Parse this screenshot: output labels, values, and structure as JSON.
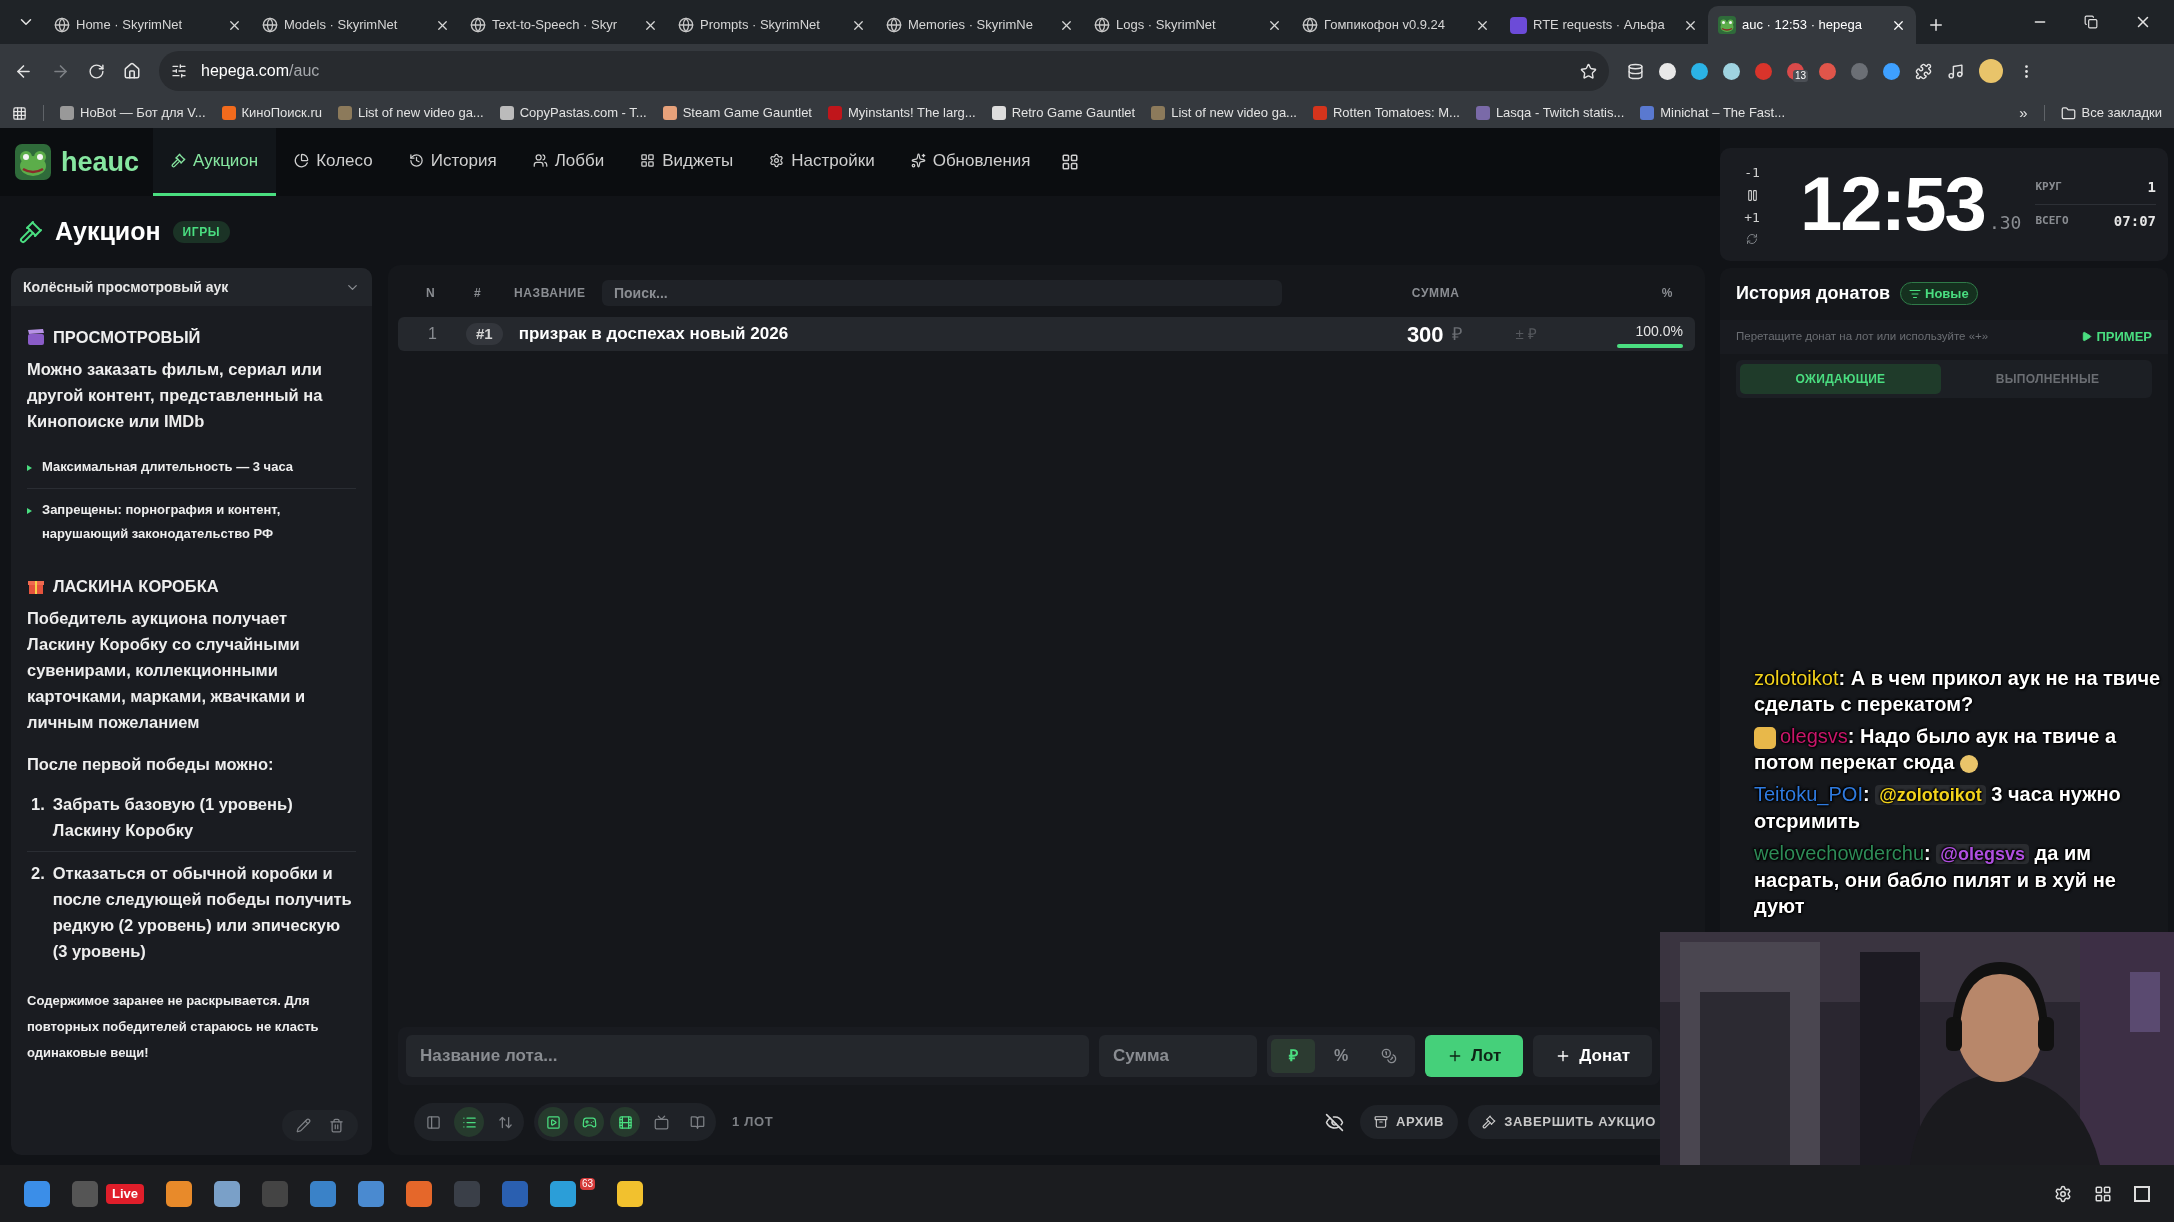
{
  "browser": {
    "tabs": [
      {
        "title": "Home · SkyrimNet",
        "selected": false
      },
      {
        "title": "Models · SkyrimNet",
        "selected": false
      },
      {
        "title": "Text-to-Speech · Skyr",
        "selected": false
      },
      {
        "title": "Prompts · SkyrimNet",
        "selected": false
      },
      {
        "title": "Memories · SkyrimNe",
        "selected": false
      },
      {
        "title": "Logs · SkyrimNet",
        "selected": false
      },
      {
        "title": "Гомпикофон v0.9.24",
        "selected": false
      },
      {
        "title": "RTE requests · Альфа",
        "selected": false
      },
      {
        "title": "auc · 12:53 · hepega",
        "selected": true
      }
    ],
    "address": {
      "host": "hepega.com",
      "path": "/auc"
    },
    "extension_badge": "13",
    "bookmarks": [
      "HoBot — Бот для V...",
      "КиноПоиск.ru",
      "List of new video ga...",
      "CopyPastas.com - T...",
      "Steam Game Gauntlet",
      "Myinstants! The larg...",
      "Retro Game Gauntlet",
      "List of new video ga...",
      "Rotten Tomatoes: M...",
      "Lasqa - Twitch statis...",
      "Minichat – The Fast..."
    ],
    "more_bookmarks": "»",
    "all_bookmarks": "Все закладки"
  },
  "app": {
    "logo": "heauc",
    "nav": [
      {
        "label": "Аукцион",
        "selected": true
      },
      {
        "label": "Колесо",
        "selected": false
      },
      {
        "label": "История",
        "selected": false
      },
      {
        "label": "Лобби",
        "selected": false
      },
      {
        "label": "Виджеты",
        "selected": false
      },
      {
        "label": "Настройки",
        "selected": false
      },
      {
        "label": "Обновления",
        "selected": false
      }
    ]
  },
  "page": {
    "title": "Аукцион",
    "badge": "ИГРЫ"
  },
  "rules": {
    "preset": "Колёсный просмотровый аук",
    "blocks": [
      {
        "kind": "heading",
        "text": "ПРОСМОТРОВЫЙ"
      },
      {
        "kind": "paragraph",
        "text": "Можно заказать фильм, сериал или другой контент, представленный на **Кинопоиске** или **IMDb**"
      },
      {
        "kind": "bullets",
        "items": [
          "Максимальная длительность — 3 часа",
          "Запрещены: порнография и контент, нарушающий законодательство РФ"
        ]
      },
      {
        "kind": "heading",
        "text": "ЛАСКИНА КОРОБКА"
      },
      {
        "kind": "paragraph",
        "text": "Победитель аукциона получает **Ласкину Коробку** со случайными сувенирами, коллекционными карточками, марками, жвачками и личным пожеланием"
      },
      {
        "kind": "subheading",
        "text": "После первой победы можно:"
      },
      {
        "kind": "numbered",
        "items": [
          {
            "number": "1.",
            "text": "Забрать базовую (1 уровень) Ласкину Коробку"
          },
          {
            "number": "2.",
            "text": "Отказаться от обычной коробки и после следующей победы получить **редкую** (2 уровень) **или эпическую** (3 уровень)"
          }
        ]
      },
      {
        "kind": "note",
        "text": "Содержимое заранее не раскрывается. Для повторных победителей стараюсь не класть одинаковые вещи!"
      }
    ]
  },
  "table": {
    "columns": [
      "N",
      "#",
      "НАЗВАНИЕ",
      "СУММА",
      "%"
    ],
    "search": {
      "placeholder": "Поиск..."
    },
    "rows": [
      {
        "n": "1",
        "id": "#1",
        "name": "призрак в доспехах новый 2026",
        "amount": "300",
        "currency": "₽",
        "adjust": "± ₽",
        "percent": "100.0%",
        "level": 1.0
      }
    ]
  },
  "add_lot": {
    "name": {
      "placeholder": "Название лота..."
    },
    "amount": {
      "placeholder": "Сумма"
    },
    "modes": [
      {
        "kind": "text",
        "label": "₽",
        "selected": true
      },
      {
        "kind": "text",
        "label": "%",
        "selected": false
      },
      {
        "kind": "icon",
        "selected": false
      }
    ],
    "buttons": [
      {
        "label": "Лот",
        "primary": true
      },
      {
        "label": "Донат",
        "primary": false
      }
    ]
  },
  "toolbar": {
    "view": [
      {
        "selected": false
      },
      {
        "selected": true
      },
      {
        "selected": false
      }
    ],
    "sources": [
      {
        "selected": true
      },
      {
        "selected": true
      },
      {
        "selected": true
      },
      {
        "selected": false
      },
      {
        "selected": false
      }
    ],
    "count": "1 ЛОТ",
    "archive": "АРХИВ",
    "finish": "ЗАВЕРШИТЬ АУКЦИО"
  },
  "timer": {
    "minus": "-1",
    "plus": "+1",
    "time": "12:53",
    "fraction": ".30",
    "stats": [
      {
        "label": "КРУГ",
        "value": "1"
      },
      {
        "label": "ВСЕГО",
        "value": "07:07"
      }
    ]
  },
  "donations": {
    "title": "История донатов",
    "sort": "Новые",
    "hint": "Перетащите донат на лот или используйте «+»",
    "example": "ПРИМЕР",
    "tabs": [
      {
        "label": "ОЖИДАЮЩИЕ",
        "selected": true
      },
      {
        "label": "ВЫПОЛНЕННЫЕ",
        "selected": false
      }
    ]
  },
  "chat": [
    {
      "user": "zolotoikot",
      "color": "#f2d21b",
      "sep": ":",
      "text": "А в чем прикол аук не на твиче сделать с перекатом?"
    },
    {
      "user": "olegsvs",
      "color": "#c8166a",
      "sep": ":",
      "badge": true,
      "text": "Надо было аук на твиче а потом перекат сюда",
      "emote": true
    },
    {
      "user": "Teitoku_POI",
      "color": "#2f7be0",
      "sep": ":",
      "mention": {
        "text": "@zolotoikot",
        "color": "#f2d21b"
      },
      "text": "3 часа нужно отсримить"
    },
    {
      "user": "welovechowderchu",
      "color": "#2e8b57",
      "sep": ":",
      "mention": {
        "text": "@olegsvs",
        "color": "#b04fe0"
      },
      "text": "да им насрать, они бабло пилят и в хуй не дуют"
    }
  ],
  "taskbar": {
    "live": "Live",
    "telegram_badge": "63"
  }
}
